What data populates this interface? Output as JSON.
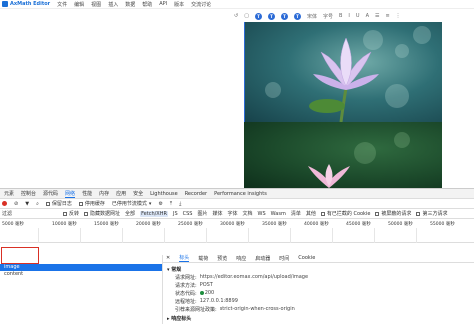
{
  "menubar": {
    "app_title": "AxMath Editor",
    "items": [
      "文件",
      "编辑",
      "视图",
      "插入",
      "数据",
      "帮助",
      "API",
      "版本",
      "交流讨论"
    ]
  },
  "toolbar": {
    "items": [
      "↺",
      "▢",
      "T",
      "T",
      "T",
      "T",
      "宋体",
      "字号",
      "B",
      "I",
      "U",
      "A",
      "☰",
      "≡",
      "⋮"
    ]
  },
  "devtools": {
    "tabs": [
      "元素",
      "控制台",
      "源代码",
      "网络",
      "性能",
      "内存",
      "应用",
      "安全",
      "Lighthouse",
      "Recorder",
      "Performance insights"
    ],
    "active_tab": "网络",
    "toolbar_checks": [
      {
        "label": "保留日志"
      },
      {
        "label": "停用缓存"
      },
      {
        "label": "已停用节流模式"
      }
    ],
    "filter_label": "过滤",
    "filter_checks": [
      "反转",
      "隐藏数据网址",
      "全部"
    ],
    "filter_types": [
      "Fetch/XHR",
      "JS",
      "CSS",
      "图片",
      "媒体",
      "字体",
      "文档",
      "WS",
      "Wasm",
      "清单",
      "其他"
    ],
    "filter_checks_right": [
      "有已拦截的 Cookie",
      "被屏蔽的请求",
      "第三方请求"
    ],
    "timeline_ticks": [
      "5000 毫秒",
      "10000 毫秒",
      "15000 毫秒",
      "20000 毫秒",
      "25000 毫秒",
      "30000 毫秒",
      "35000 毫秒",
      "40000 毫秒",
      "45000 毫秒",
      "50000 毫秒",
      "55000 毫秒"
    ],
    "requests": [
      {
        "name": "image"
      },
      {
        "name": "content"
      }
    ],
    "details": {
      "tabs": [
        "标头",
        "载荷",
        "预览",
        "响应",
        "启动器",
        "时间",
        "Cookie"
      ],
      "active_tab": "标头",
      "section": "▾ 常规",
      "rows": [
        {
          "key": "请求网址:",
          "value": "https://editor.eomax.com/api/upload/image"
        },
        {
          "key": "请求方法:",
          "value": "POST"
        },
        {
          "key": "状态代码:",
          "value": "200"
        },
        {
          "key": "远程地址:",
          "value": "127.0.0.1:8899"
        },
        {
          "key": "引荐来源网址政策:",
          "value": "strict-origin-when-cross-origin"
        }
      ],
      "footer": "▸ 响应标头"
    }
  }
}
